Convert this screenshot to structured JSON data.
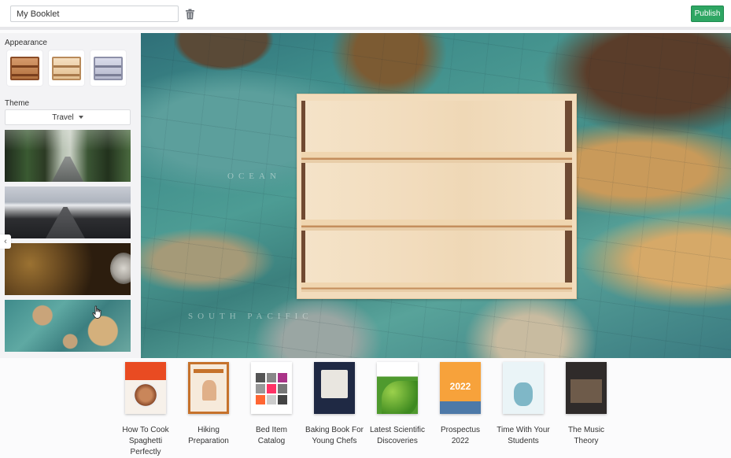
{
  "header": {
    "booklet_name": "My Booklet",
    "publish_label": "Publish"
  },
  "sidebar": {
    "appearance_label": "Appearance",
    "shelf_styles": [
      "wood-dark",
      "wood-light",
      "silver"
    ],
    "theme_label": "Theme",
    "theme_selected": "Travel",
    "theme_images": [
      "forest-road",
      "snowy-road",
      "vintage-clock",
      "world-map"
    ],
    "collapse_glyph": "‹"
  },
  "canvas": {
    "background": "world-map",
    "map_labels": [
      "OCEAN",
      "SOUTH PACIFIC"
    ]
  },
  "books": [
    {
      "title": "How To Cook Spaghetti Perfectly"
    },
    {
      "title": "Hiking Preparation"
    },
    {
      "title": "Bed Item Catalog"
    },
    {
      "title": "Baking Book For Young Chefs"
    },
    {
      "title": "Latest Scientific Discoveries"
    },
    {
      "title": "Prospectus 2022"
    },
    {
      "title": "Time With Your Students"
    },
    {
      "title": "The Music Theory"
    }
  ],
  "colors": {
    "accent_green": "#2ea663",
    "sidebar_bg": "#f3f3f5"
  }
}
